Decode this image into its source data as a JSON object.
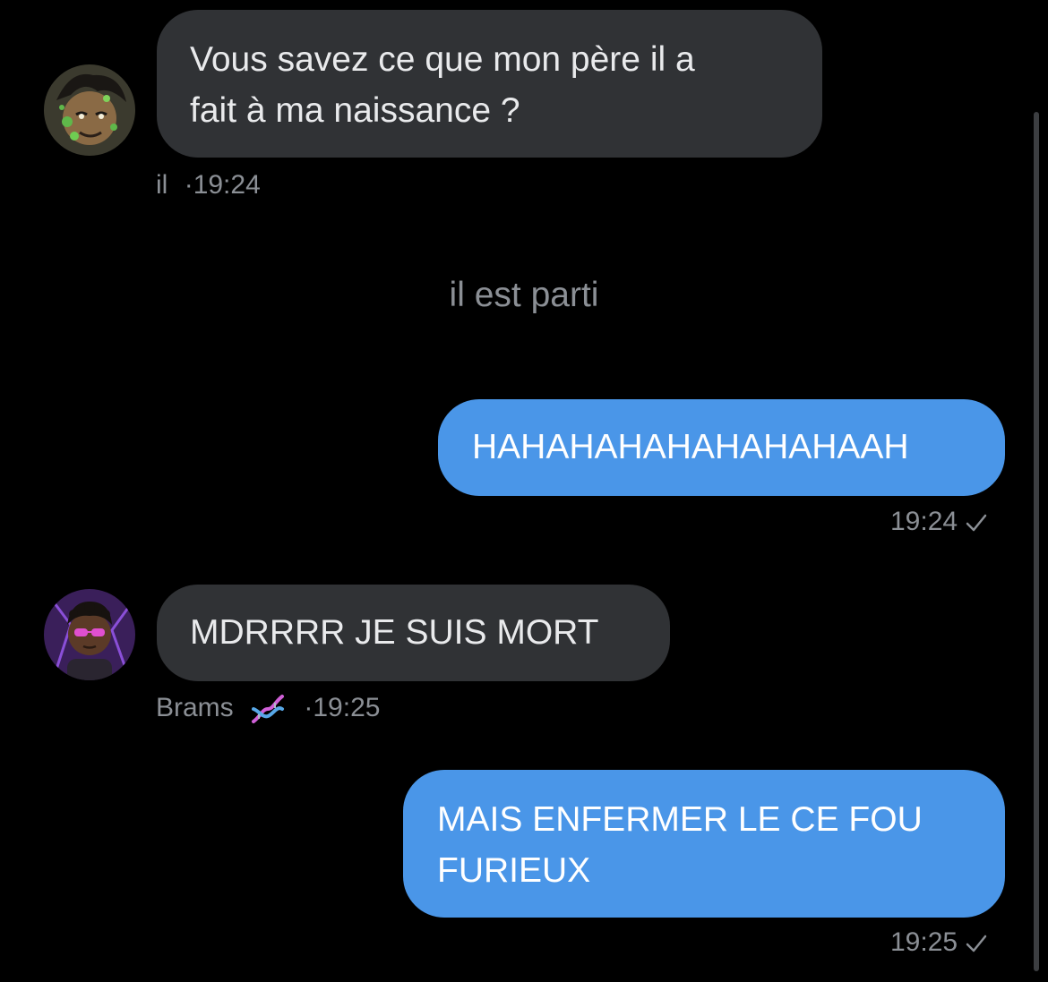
{
  "messages": [
    {
      "direction": "incoming",
      "text": "Vous savez ce que mon père il a\nfait à ma naissance ?",
      "sender": "il",
      "separator": "·",
      "time": "19:24",
      "avatar": "anime-avatar-green"
    },
    {
      "direction": "system",
      "text": "il est parti"
    },
    {
      "direction": "outgoing",
      "text": "HAHAHAHAHAHAHAHAAH",
      "time": "19:24",
      "status_icon": "checkmark-icon"
    },
    {
      "direction": "incoming",
      "text": "MDRRRR JE SUIS MORT",
      "sender": "Brams",
      "sender_emoji": "dna-icon",
      "separator": "·",
      "time": "19:25",
      "avatar": "anime-avatar-purple"
    },
    {
      "direction": "outgoing",
      "text": "MAIS ENFERMER LE CE FOU\nFURIEUX",
      "time": "19:25",
      "status_icon": "checkmark-icon"
    }
  ],
  "colors": {
    "background": "#000000",
    "incoming_bubble": "#303235",
    "outgoing_bubble": "#4a96e8",
    "meta_text": "#8b8f95"
  }
}
